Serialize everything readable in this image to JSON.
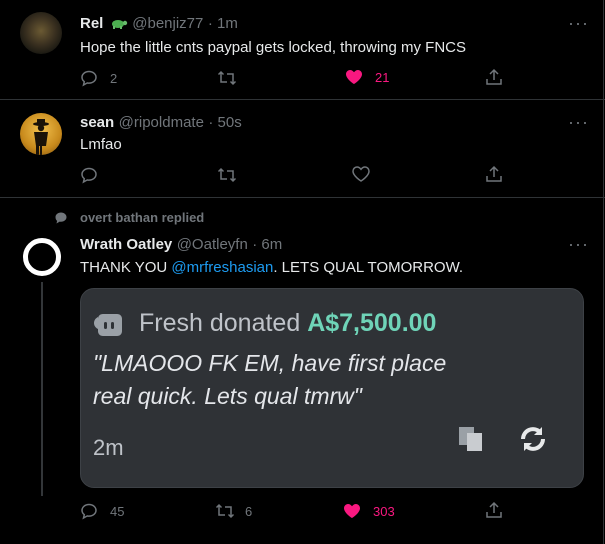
{
  "tweets": [
    {
      "name": "Rel",
      "handle": "@benjiz77",
      "time": "· 1m",
      "text": "Hope the little cnts paypal gets locked, throwing my FNCS",
      "replies": "2",
      "retweets": "",
      "likes": "21"
    },
    {
      "name": "sean",
      "handle": "@ripoldmate",
      "time": "· 50s",
      "text": "Lmfao",
      "replies": "",
      "retweets": "",
      "likes": ""
    },
    {
      "context": "overt bathan replied",
      "name": "Wrath Oatley",
      "handle": "@Oatleyfn",
      "time": "· 6m",
      "text_before": "THANK YOU ",
      "mention": "@mrfreshasian",
      "text_after": ". LETS QUAL TOMORROW.",
      "replies": "45",
      "retweets": "6",
      "likes": "303"
    }
  ],
  "donation": {
    "donor": "Fresh",
    "donated_word": "donated",
    "amount": "A$7,500.00",
    "message_line1": "\"LMAOOO FK EM, have first place",
    "message_line2": "real quick. Lets qual tmrw\"",
    "time": "2m"
  },
  "colors": {
    "background": "#000000",
    "like_pink": "#f91880",
    "mention_blue": "#1d9bf0",
    "donation_green": "#6fd4b8"
  },
  "icons": [
    "more-icon",
    "reply-icon",
    "retweet-icon",
    "like-icon",
    "share-icon",
    "turtle-emoji-icon",
    "comment-bubble-icon",
    "streamlabs-icon",
    "copy-icon",
    "refresh-icon"
  ]
}
